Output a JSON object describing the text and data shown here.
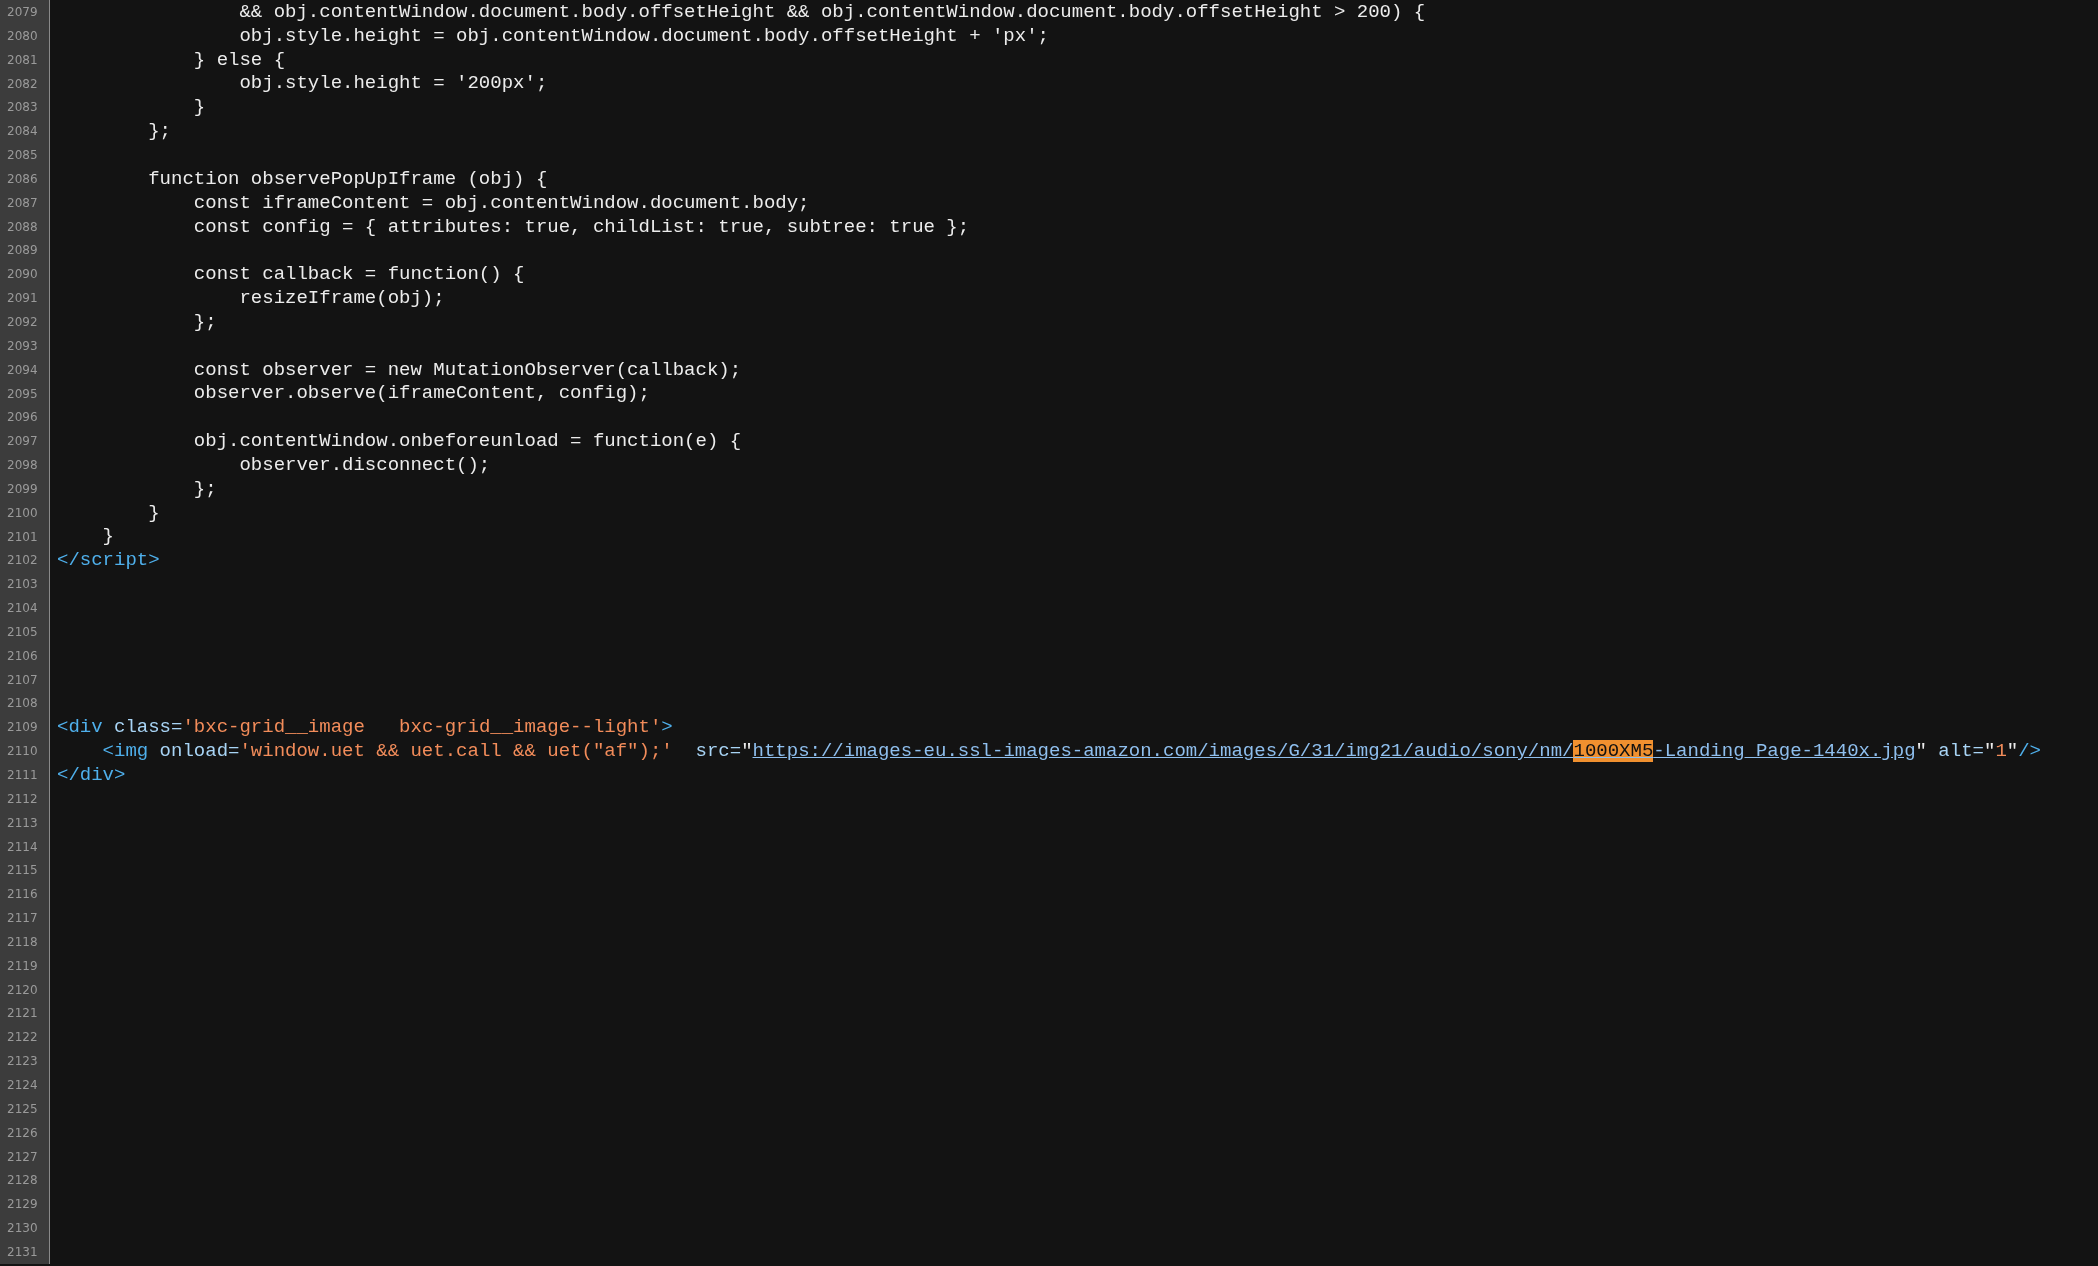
{
  "lines": [
    {
      "number": "2079",
      "segments": [
        {
          "kind": "plain",
          "text": "                && obj.contentWindow.document.body.offsetHeight && obj.contentWindow.document.body.offsetHeight > 200) {"
        }
      ]
    },
    {
      "number": "2080",
      "segments": [
        {
          "kind": "plain",
          "text": "                obj.style.height = obj.contentWindow.document.body.offsetHeight + 'px';"
        }
      ]
    },
    {
      "number": "2081",
      "segments": [
        {
          "kind": "plain",
          "text": "            } else {"
        }
      ]
    },
    {
      "number": "2082",
      "segments": [
        {
          "kind": "plain",
          "text": "                obj.style.height = '200px';"
        }
      ]
    },
    {
      "number": "2083",
      "segments": [
        {
          "kind": "plain",
          "text": "            }"
        }
      ]
    },
    {
      "number": "2084",
      "segments": [
        {
          "kind": "plain",
          "text": "        };"
        }
      ]
    },
    {
      "number": "2085"
    },
    {
      "number": "2086",
      "segments": [
        {
          "kind": "plain",
          "text": "        function observePopUpIframe (obj) {"
        }
      ]
    },
    {
      "number": "2087",
      "segments": [
        {
          "kind": "plain",
          "text": "            const iframeContent = obj.contentWindow.document.body;"
        }
      ]
    },
    {
      "number": "2088",
      "segments": [
        {
          "kind": "plain",
          "text": "            const config = { attributes: true, childList: true, subtree: true };"
        }
      ]
    },
    {
      "number": "2089"
    },
    {
      "number": "2090",
      "segments": [
        {
          "kind": "plain",
          "text": "            const callback = function() {"
        }
      ]
    },
    {
      "number": "2091",
      "segments": [
        {
          "kind": "plain",
          "text": "                resizeIframe(obj);"
        }
      ]
    },
    {
      "number": "2092",
      "segments": [
        {
          "kind": "plain",
          "text": "            };"
        }
      ]
    },
    {
      "number": "2093"
    },
    {
      "number": "2094",
      "segments": [
        {
          "kind": "plain",
          "text": "            const observer = new MutationObserver(callback);"
        }
      ]
    },
    {
      "number": "2095",
      "segments": [
        {
          "kind": "plain",
          "text": "            observer.observe(iframeContent, config);"
        }
      ]
    },
    {
      "number": "2096"
    },
    {
      "number": "2097",
      "segments": [
        {
          "kind": "plain",
          "text": "            obj.contentWindow.onbeforeunload = function(e) {"
        }
      ]
    },
    {
      "number": "2098",
      "segments": [
        {
          "kind": "plain",
          "text": "                observer.disconnect();"
        }
      ]
    },
    {
      "number": "2099",
      "segments": [
        {
          "kind": "plain",
          "text": "            };"
        }
      ]
    },
    {
      "number": "2100",
      "segments": [
        {
          "kind": "plain",
          "text": "        }"
        }
      ]
    },
    {
      "number": "2101",
      "segments": [
        {
          "kind": "plain",
          "text": "    }"
        }
      ]
    },
    {
      "number": "2102",
      "segments": [
        {
          "kind": "tag",
          "text": "</script>"
        }
      ]
    },
    {
      "number": "2103"
    },
    {
      "number": "2104"
    },
    {
      "number": "2105"
    },
    {
      "number": "2106"
    },
    {
      "number": "2107"
    },
    {
      "number": "2108"
    },
    {
      "number": "2109",
      "segments": [
        {
          "kind": "tag",
          "text": "<div"
        },
        {
          "kind": "attr",
          "text": " class="
        },
        {
          "kind": "value",
          "text": "'bxc-grid__image   bxc-grid__image--light'"
        },
        {
          "kind": "tag",
          "text": ">"
        }
      ]
    },
    {
      "number": "2110",
      "segments": [
        {
          "kind": "tag",
          "text": "    <img"
        },
        {
          "kind": "attr",
          "text": " onload="
        },
        {
          "kind": "value",
          "text": "'window.uet && uet.call && uet(\"af\");'"
        },
        {
          "kind": "attr",
          "text": "  src="
        },
        {
          "kind": "plain",
          "text": "\""
        },
        {
          "kind": "link",
          "parts": [
            {
              "text": "https://images-eu.ssl-images-amazon.com/images/G/31/img21/audio/sony/nm/",
              "highlighted": false
            },
            {
              "text": "1000XM5",
              "highlighted": true
            },
            {
              "text": "-Landing_Page-1440x.jpg",
              "highlighted": false
            }
          ]
        },
        {
          "kind": "plain",
          "text": "\""
        },
        {
          "kind": "attr",
          "text": " alt="
        },
        {
          "kind": "plain",
          "text": "\""
        },
        {
          "kind": "value",
          "text": "1"
        },
        {
          "kind": "plain",
          "text": "\""
        },
        {
          "kind": "tag",
          "text": "/>"
        }
      ]
    },
    {
      "number": "2111",
      "segments": [
        {
          "kind": "tag",
          "text": "</div>"
        }
      ]
    },
    {
      "number": "2112"
    },
    {
      "number": "2113"
    },
    {
      "number": "2114"
    },
    {
      "number": "2115"
    },
    {
      "number": "2116"
    },
    {
      "number": "2117"
    },
    {
      "number": "2118"
    },
    {
      "number": "2119"
    },
    {
      "number": "2120"
    },
    {
      "number": "2121"
    },
    {
      "number": "2122"
    },
    {
      "number": "2123"
    },
    {
      "number": "2124"
    },
    {
      "number": "2125"
    },
    {
      "number": "2126"
    },
    {
      "number": "2127"
    },
    {
      "number": "2128"
    },
    {
      "number": "2129"
    },
    {
      "number": "2130"
    },
    {
      "number": "2131"
    }
  ]
}
